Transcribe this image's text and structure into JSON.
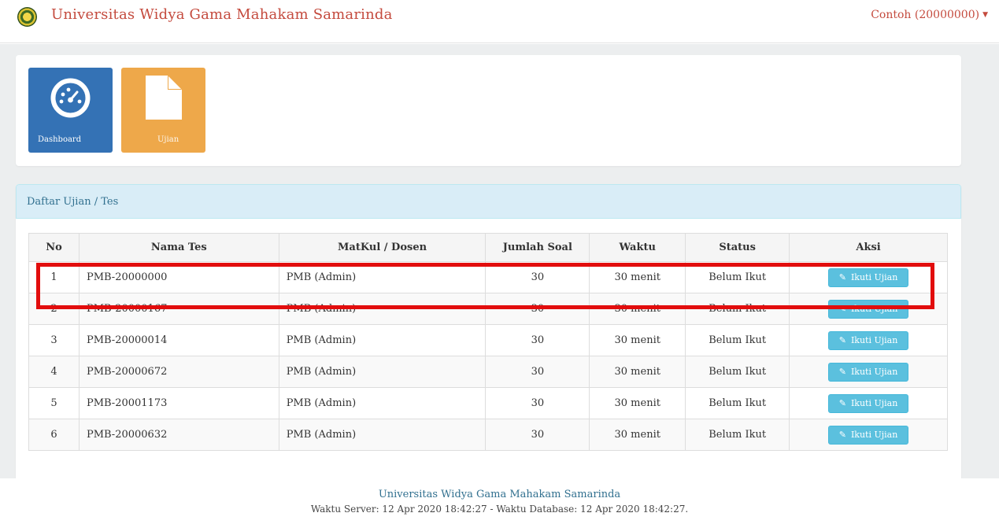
{
  "navbar": {
    "title": "Universitas Widya Gama Mahakam Samarinda",
    "user": "Contoh (20000000)",
    "logo_icon": "university-seal-icon"
  },
  "menu": {
    "tiles": [
      {
        "label": "Dashboard",
        "icon": "dashboard-gauge-icon",
        "color": "#3472b5"
      },
      {
        "label": "Ujian",
        "icon": "document-icon",
        "color": "#eea84a"
      }
    ]
  },
  "exam_list": {
    "title": "Daftar Ujian / Tes",
    "columns": [
      "No",
      "Nama Tes",
      "MatKul / Dosen",
      "Jumlah Soal",
      "Waktu",
      "Status",
      "Aksi"
    ],
    "action_label": "Ikuti Ujian",
    "rows": [
      {
        "no": "1",
        "nama": "PMB-20000000",
        "matkul": "PMB (Admin)",
        "jumlah": "30",
        "waktu": "30 menit",
        "status": "Belum Ikut"
      },
      {
        "no": "2",
        "nama": "PMB-20000167",
        "matkul": "PMB (Admin)",
        "jumlah": "30",
        "waktu": "30 menit",
        "status": "Belum Ikut"
      },
      {
        "no": "3",
        "nama": "PMB-20000014",
        "matkul": "PMB (Admin)",
        "jumlah": "30",
        "waktu": "30 menit",
        "status": "Belum Ikut"
      },
      {
        "no": "4",
        "nama": "PMB-20000672",
        "matkul": "PMB (Admin)",
        "jumlah": "30",
        "waktu": "30 menit",
        "status": "Belum Ikut"
      },
      {
        "no": "5",
        "nama": "PMB-20001173",
        "matkul": "PMB (Admin)",
        "jumlah": "30",
        "waktu": "30 menit",
        "status": "Belum Ikut"
      },
      {
        "no": "6",
        "nama": "PMB-20000632",
        "matkul": "PMB (Admin)",
        "jumlah": "30",
        "waktu": "30 menit",
        "status": "Belum Ikut"
      }
    ]
  },
  "footer": {
    "name": "Universitas Widya Gama Mahakam Samarinda",
    "time": "Waktu Server: 12 Apr 2020 18:42:27 - Waktu Database: 12 Apr 2020 18:42:27."
  },
  "colors": {
    "brand": "#c44a3d",
    "panel_header": "#d9edf7",
    "action_button": "#5bc0de",
    "highlight": "#e20d0d"
  }
}
